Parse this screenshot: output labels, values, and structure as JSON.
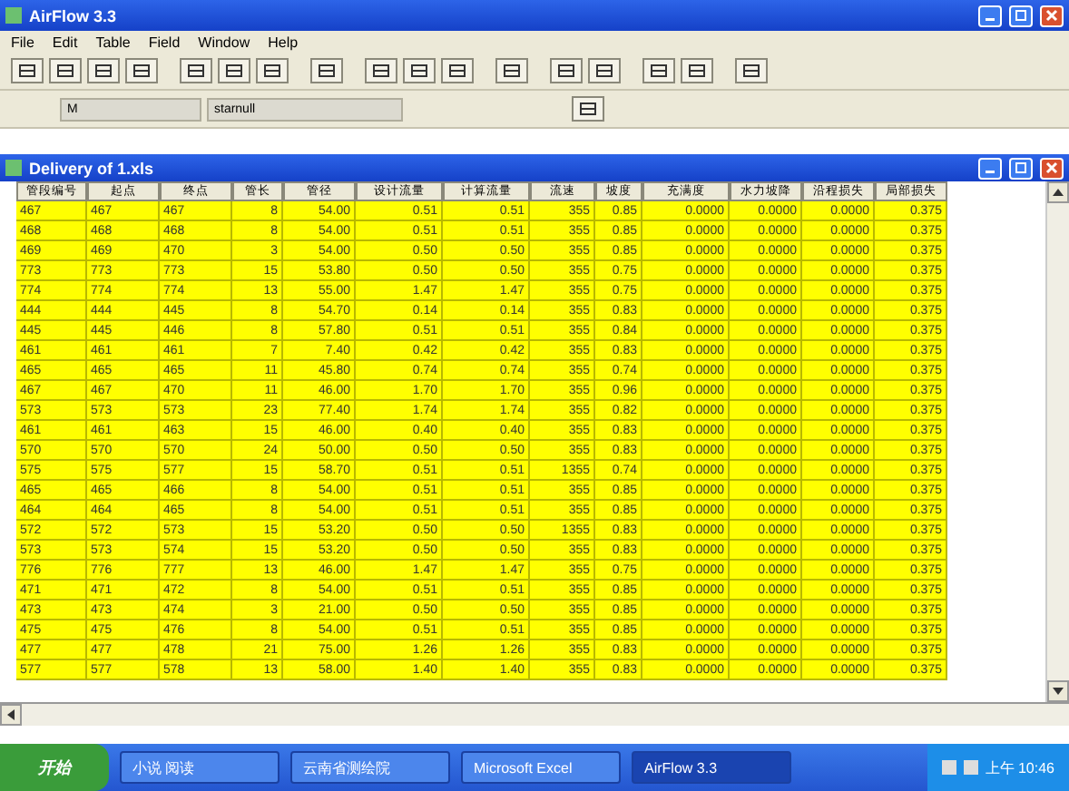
{
  "window": {
    "title": "AirFlow 3.3"
  },
  "menu": [
    "File",
    "Edit",
    "Table",
    "Field",
    "Window",
    "Help"
  ],
  "toolbar2": {
    "field_1": "M",
    "field_2": "starnull"
  },
  "child": {
    "title": "Delivery of 1.xls"
  },
  "table": {
    "columns": [
      "管段编号",
      "起点",
      "终点",
      "管长",
      "管径",
      "设计流量",
      "计算流量",
      "流速",
      "坡度",
      "充满度",
      "水力坡降",
      "沿程损失",
      "局部损失"
    ],
    "rows": [
      [
        "467",
        "467",
        "467",
        "8",
        "54.00",
        "0.51",
        "0.51",
        "355",
        "0.85",
        "0.0000",
        "0.0000",
        "0.0000",
        "0.375"
      ],
      [
        "468",
        "468",
        "468",
        "8",
        "54.00",
        "0.51",
        "0.51",
        "355",
        "0.85",
        "0.0000",
        "0.0000",
        "0.0000",
        "0.375"
      ],
      [
        "469",
        "469",
        "470",
        "3",
        "54.00",
        "0.50",
        "0.50",
        "355",
        "0.85",
        "0.0000",
        "0.0000",
        "0.0000",
        "0.375"
      ],
      [
        "773",
        "773",
        "773",
        "15",
        "53.80",
        "0.50",
        "0.50",
        "355",
        "0.75",
        "0.0000",
        "0.0000",
        "0.0000",
        "0.375"
      ],
      [
        "774",
        "774",
        "774",
        "13",
        "55.00",
        "1.47",
        "1.47",
        "355",
        "0.75",
        "0.0000",
        "0.0000",
        "0.0000",
        "0.375"
      ],
      [
        "444",
        "444",
        "445",
        "8",
        "54.70",
        "0.14",
        "0.14",
        "355",
        "0.83",
        "0.0000",
        "0.0000",
        "0.0000",
        "0.375"
      ],
      [
        "445",
        "445",
        "446",
        "8",
        "57.80",
        "0.51",
        "0.51",
        "355",
        "0.84",
        "0.0000",
        "0.0000",
        "0.0000",
        "0.375"
      ],
      [
        "461",
        "461",
        "461",
        "7",
        "7.40",
        "0.42",
        "0.42",
        "355",
        "0.83",
        "0.0000",
        "0.0000",
        "0.0000",
        "0.375"
      ],
      [
        "465",
        "465",
        "465",
        "11",
        "45.80",
        "0.74",
        "0.74",
        "355",
        "0.74",
        "0.0000",
        "0.0000",
        "0.0000",
        "0.375"
      ],
      [
        "467",
        "467",
        "470",
        "11",
        "46.00",
        "1.70",
        "1.70",
        "355",
        "0.96",
        "0.0000",
        "0.0000",
        "0.0000",
        "0.375"
      ],
      [
        "573",
        "573",
        "573",
        "23",
        "77.40",
        "1.74",
        "1.74",
        "355",
        "0.82",
        "0.0000",
        "0.0000",
        "0.0000",
        "0.375"
      ],
      [
        "461",
        "461",
        "463",
        "15",
        "46.00",
        "0.40",
        "0.40",
        "355",
        "0.83",
        "0.0000",
        "0.0000",
        "0.0000",
        "0.375"
      ],
      [
        "570",
        "570",
        "570",
        "24",
        "50.00",
        "0.50",
        "0.50",
        "355",
        "0.83",
        "0.0000",
        "0.0000",
        "0.0000",
        "0.375"
      ],
      [
        "575",
        "575",
        "577",
        "15",
        "58.70",
        "0.51",
        "0.51",
        "1355",
        "0.74",
        "0.0000",
        "0.0000",
        "0.0000",
        "0.375"
      ],
      [
        "465",
        "465",
        "466",
        "8",
        "54.00",
        "0.51",
        "0.51",
        "355",
        "0.85",
        "0.0000",
        "0.0000",
        "0.0000",
        "0.375"
      ],
      [
        "464",
        "464",
        "465",
        "8",
        "54.00",
        "0.51",
        "0.51",
        "355",
        "0.85",
        "0.0000",
        "0.0000",
        "0.0000",
        "0.375"
      ],
      [
        "572",
        "572",
        "573",
        "15",
        "53.20",
        "0.50",
        "0.50",
        "1355",
        "0.83",
        "0.0000",
        "0.0000",
        "0.0000",
        "0.375"
      ],
      [
        "573",
        "573",
        "574",
        "15",
        "53.20",
        "0.50",
        "0.50",
        "355",
        "0.83",
        "0.0000",
        "0.0000",
        "0.0000",
        "0.375"
      ],
      [
        "776",
        "776",
        "777",
        "13",
        "46.00",
        "1.47",
        "1.47",
        "355",
        "0.75",
        "0.0000",
        "0.0000",
        "0.0000",
        "0.375"
      ],
      [
        "471",
        "471",
        "472",
        "8",
        "54.00",
        "0.51",
        "0.51",
        "355",
        "0.85",
        "0.0000",
        "0.0000",
        "0.0000",
        "0.375"
      ],
      [
        "473",
        "473",
        "474",
        "3",
        "21.00",
        "0.50",
        "0.50",
        "355",
        "0.85",
        "0.0000",
        "0.0000",
        "0.0000",
        "0.375"
      ],
      [
        "475",
        "475",
        "476",
        "8",
        "54.00",
        "0.51",
        "0.51",
        "355",
        "0.85",
        "0.0000",
        "0.0000",
        "0.0000",
        "0.375"
      ],
      [
        "477",
        "477",
        "478",
        "21",
        "75.00",
        "1.26",
        "1.26",
        "355",
        "0.83",
        "0.0000",
        "0.0000",
        "0.0000",
        "0.375"
      ],
      [
        "577",
        "577",
        "578",
        "13",
        "58.00",
        "1.40",
        "1.40",
        "355",
        "0.83",
        "0.0000",
        "0.0000",
        "0.0000",
        "0.375"
      ]
    ]
  },
  "taskbar": {
    "start": "开始",
    "items": [
      {
        "label": "小说 阅读",
        "selected": false
      },
      {
        "label": "云南省测绘院",
        "selected": false
      },
      {
        "label": "Microsoft Excel",
        "selected": false
      },
      {
        "label": "AirFlow 3.3",
        "selected": true
      }
    ],
    "clock": "上午 10:46"
  }
}
